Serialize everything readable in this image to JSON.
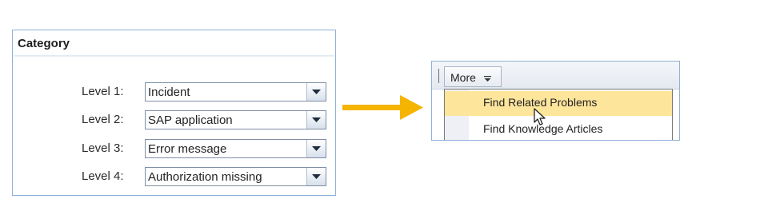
{
  "category": {
    "title": "Category",
    "levels": [
      {
        "label": "Level 1:",
        "value": "Incident"
      },
      {
        "label": "Level 2:",
        "value": "SAP application"
      },
      {
        "label": "Level 3:",
        "value": "Error message"
      },
      {
        "label": "Level 4:",
        "value": "Authorization missing"
      }
    ]
  },
  "arrow": {
    "icon": "arrow-right-icon",
    "color": "#f5b400"
  },
  "more_menu": {
    "button_label": "More",
    "button_icon": "chevron-down-icon",
    "items": [
      {
        "label": "Find Related Problems",
        "highlighted": true
      },
      {
        "label": "Find Knowledge Articles",
        "highlighted": false
      }
    ]
  },
  "colors": {
    "panel_border": "#8fb0d8",
    "highlight": "#fde59c"
  }
}
